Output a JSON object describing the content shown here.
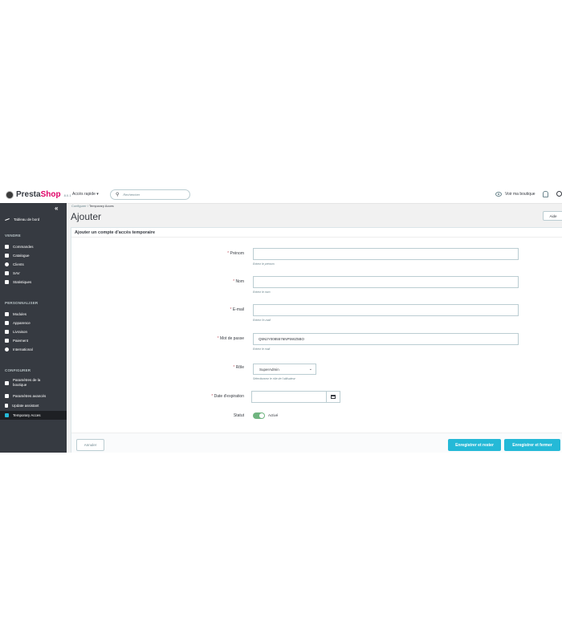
{
  "header": {
    "logo_a": "Presta",
    "logo_b": "Shop",
    "version": "8.0.1",
    "quick_access": "Accès rapide ▾",
    "search_placeholder": "Rechercher",
    "view_shop": "Voir ma boutique"
  },
  "sidebar": {
    "collapse": "«",
    "dashboard": "Tableau de bord",
    "section_sell": "VENDRE",
    "orders": "Commandes",
    "catalog": "Catalogue",
    "clients": "Clients",
    "sav": "SAV",
    "stats": "Statistiques",
    "section_customize": "PERSONNALISER",
    "modules": "Modules",
    "appearance": "Apparence",
    "shipping": "Livraison",
    "payment": "Paiement",
    "international": "International",
    "section_configure": "CONFIGURER",
    "shop_params_1": "Paramètres de la",
    "shop_params_2": "boutique",
    "advanced_params": "Paramètres avancés",
    "update_assistant": "Update assistant",
    "temporary_access": "Temporary Acces"
  },
  "breadcrumb": {
    "parent": "Configurer",
    "sep": "/",
    "current": "Temporary Acces"
  },
  "page": {
    "title": "Ajouter",
    "help": "Aide"
  },
  "form": {
    "heading": "Ajouter un compte d'accès temporaire",
    "required_mark": "*",
    "firstname": {
      "label": "Prénom",
      "value": "",
      "hint": "Entrez le prénom"
    },
    "lastname": {
      "label": "Nom",
      "value": "",
      "hint": "Entrez le nom"
    },
    "email": {
      "label": "E-mail",
      "value": "",
      "hint": "Entrez l'e-mail"
    },
    "password": {
      "label": "Mot de passe",
      "value": "Q5N2Y0085576NP5WZ5BO",
      "hint": "Entrez le mail"
    },
    "role": {
      "label": "Rôle",
      "value": "SuperAdmin",
      "hint": "Sélectionnez le rôle de l'utilisateur"
    },
    "expiration": {
      "label": "Date d'expiration",
      "value": ""
    },
    "status": {
      "label": "Statut",
      "value": "Activé",
      "on": true
    }
  },
  "footer": {
    "cancel": "Annuler",
    "save_stay": "Enregistrer et rester",
    "save_close": "Enregistrer et fermer"
  },
  "colors": {
    "accent": "#25b9d7",
    "sidebar": "#363a41",
    "brand": "#df0067",
    "toggle_on": "#70b580"
  }
}
